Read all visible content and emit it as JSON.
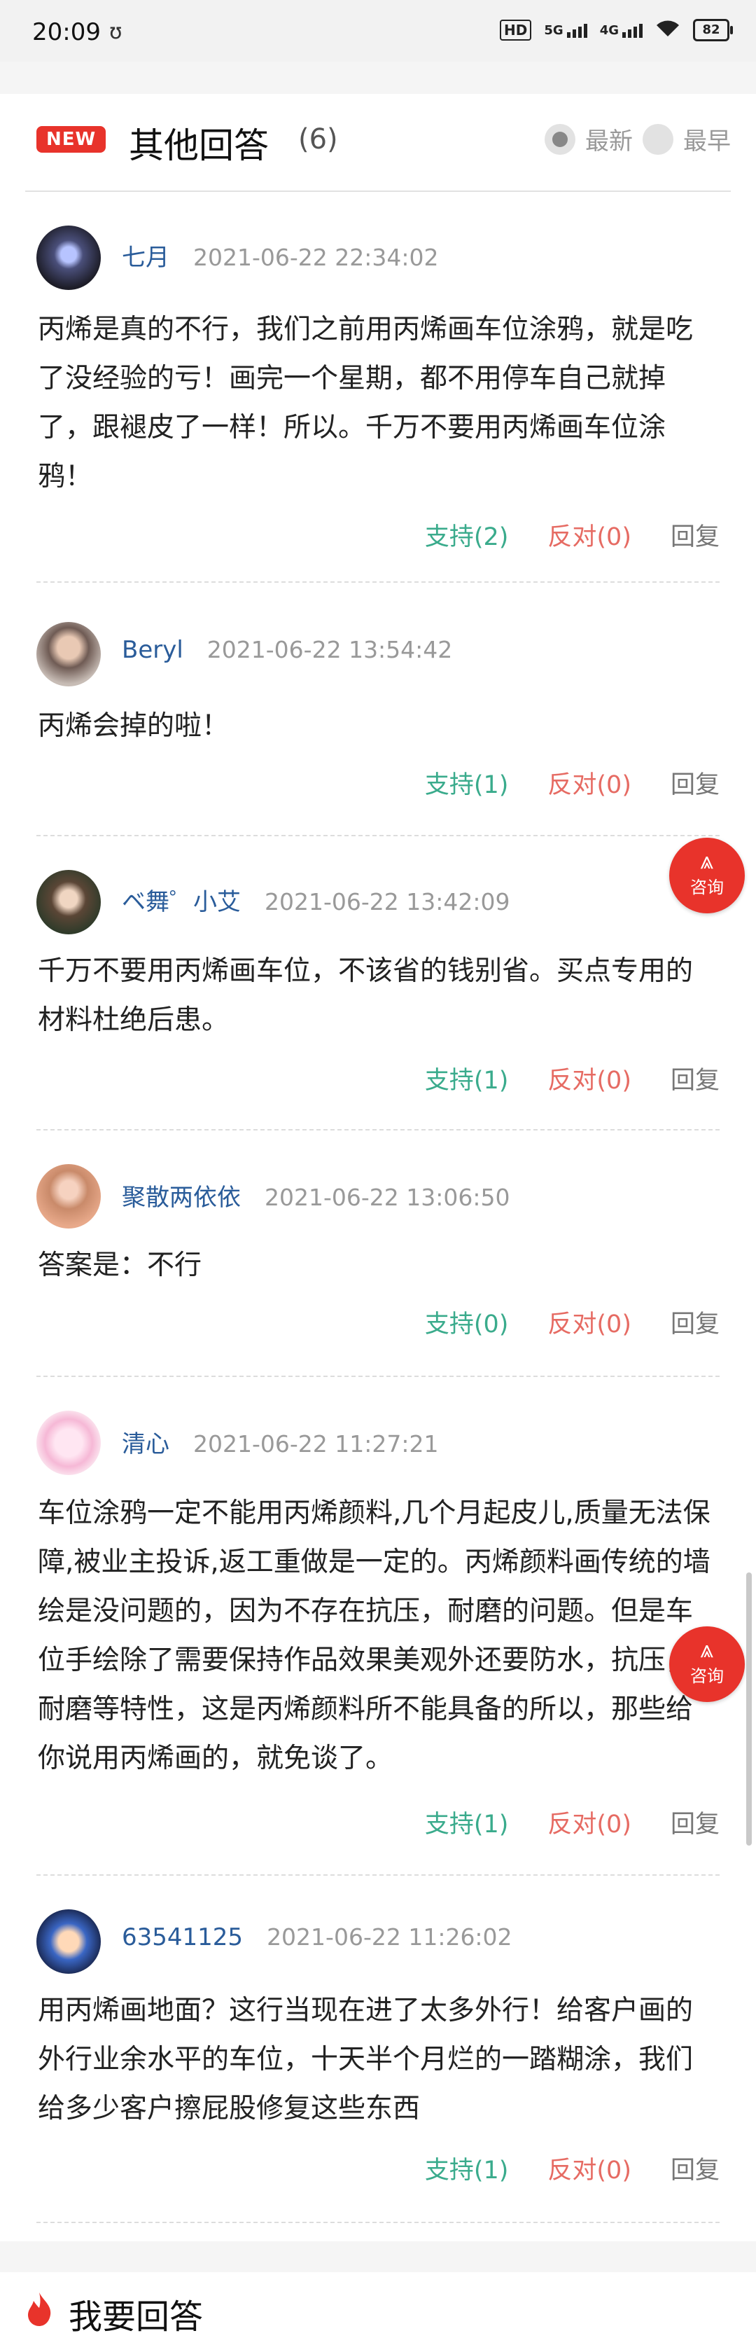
{
  "status_bar": {
    "time": "20:09",
    "sync_icon": "ʊ",
    "hd_label": "HD",
    "net1": "5G",
    "net2": "4G",
    "battery": "82"
  },
  "header": {
    "badge": "NEW",
    "title": "其他回答",
    "count": "(6)",
    "sort_latest": "最新",
    "sort_earliest": "最早"
  },
  "answers": [
    {
      "user": "七月",
      "date": "2021-06-22 22:34:02",
      "content": "丙烯是真的不行，我们之前用丙烯画车位涂鸦，就是吃了没经验的亏！画完一个星期，都不用停车自己就掉了，跟褪皮了一样！所以。千万不要用丙烯画车位涂鸦！",
      "support": "支持(2)",
      "oppose": "反对(0)",
      "reply": "回复"
    },
    {
      "user": "Beryl",
      "date": "2021-06-22 13:54:42",
      "content": "丙烯会掉的啦！",
      "support": "支持(1)",
      "oppose": "反对(0)",
      "reply": "回复"
    },
    {
      "user": "ベ舞゜小艾",
      "date": "2021-06-22 13:42:09",
      "content": "千万不要用丙烯画车位，不该省的钱别省。买点专用的材料杜绝后患。",
      "support": "支持(1)",
      "oppose": "反对(0)",
      "reply": "回复"
    },
    {
      "user": "聚散两依依",
      "date": "2021-06-22 13:06:50",
      "content": "答案是：不行",
      "support": "支持(0)",
      "oppose": "反对(0)",
      "reply": "回复"
    },
    {
      "user": "清心",
      "date": "2021-06-22 11:27:21",
      "content": "车位涂鸦一定不能用丙烯颜料,几个月起皮儿,质量无法保障,被业主投诉,返工重做是一定的。丙烯颜料画传统的墙绘是没问题的，因为不存在抗压，耐磨的问题。但是车位手绘除了需要保持作品效果美观外还要防水，抗压，耐磨等特性，这是丙烯颜料所不能具备的所以，那些给你说用丙烯画的，就免谈了。",
      "support": "支持(1)",
      "oppose": "反对(0)",
      "reply": "回复"
    },
    {
      "user": "63541125",
      "date": "2021-06-22 11:26:02",
      "content": "用丙烯画地面？这行当现在进了太多外行！给客户画的外行业余水平的车位，十天半个月烂的一踏糊涂，我们给多少客户擦屁股修复这些东西",
      "support": "支持(1)",
      "oppose": "反对(0)",
      "reply": "回复"
    }
  ],
  "consult": {
    "label": "咨询"
  },
  "bottom": {
    "label": "我要回答"
  },
  "colors": {
    "accent_red": "#e8332b",
    "support_green": "#3aab8c",
    "oppose_red": "#e66b63",
    "username_blue": "#2a5c9a"
  }
}
